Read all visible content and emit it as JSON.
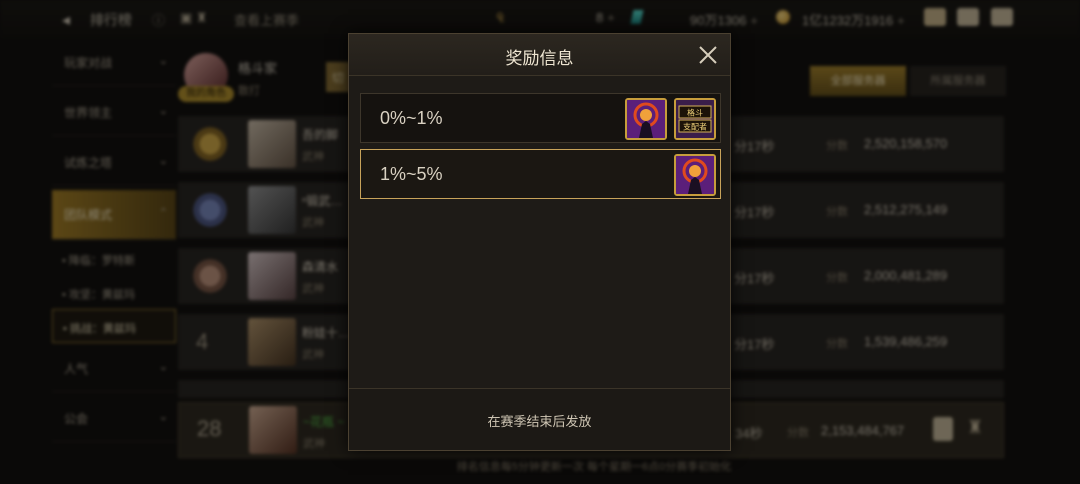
{
  "topbar": {
    "title": "排行榜",
    "prev_season": "查看上赛季",
    "currency1": "8",
    "currency2": "90万1306",
    "currency3": "1亿1232万1916"
  },
  "sidebar": {
    "items": [
      {
        "label": "玩家对战"
      },
      {
        "label": "世界领主"
      },
      {
        "label": "试炼之塔"
      },
      {
        "label": "团队模式"
      },
      {
        "label": "人气"
      },
      {
        "label": "公会"
      }
    ],
    "subitems": [
      {
        "label": "• 降临：罗特斯"
      },
      {
        "label": "• 攻坚：黄兹玛"
      },
      {
        "label": "• 挑战：黄兹玛"
      }
    ]
  },
  "me": {
    "name": "格斗家",
    "sub": "散打",
    "tag": "我的角色",
    "switch_label": "切"
  },
  "server_tabs": {
    "all": "全部服务器",
    "own": "所属服务器"
  },
  "rows": [
    {
      "rank": "1",
      "name": "吾的脚",
      "title": "武神",
      "time": "分17秒",
      "score_label": "分数",
      "score": "2,520,158,570"
    },
    {
      "rank": "2",
      "name": "ⁿ锻武…",
      "title": "武神",
      "time": "分17秒",
      "score_label": "分数",
      "score": "2,512,275,149"
    },
    {
      "rank": "3",
      "name": "森清水",
      "title": "武神",
      "time": "分17秒",
      "score_label": "分数",
      "score": "2,000,481,289"
    },
    {
      "rank": "4",
      "name": "粉娃十…",
      "title": "武神",
      "time": "分17秒",
      "score_label": "分数",
      "score": "1,539,486,259"
    }
  ],
  "my_row": {
    "rank": "28",
    "name": "~花瓶 ~",
    "title": "武神",
    "time": "34秒",
    "score_label": "分数",
    "score": "2,153,484,767"
  },
  "footer_note": "排名信息每5分钟更新一次 每个星期一6点0分赛季初始化",
  "modal": {
    "title": "奖励信息",
    "rewards": [
      {
        "range": "0%~1%",
        "items": [
          "title-card-icon",
          "hero-card-icon"
        ]
      },
      {
        "range": "1%~5%",
        "items": [
          "title-card-icon"
        ]
      }
    ],
    "footer": "在赛季结束后发放",
    "badge_text": "格斗\n支配者"
  },
  "colors": {
    "accent_gold": "#c8a35a",
    "modal_bg": "#1e1b17",
    "item_border": "#c79d3c"
  }
}
